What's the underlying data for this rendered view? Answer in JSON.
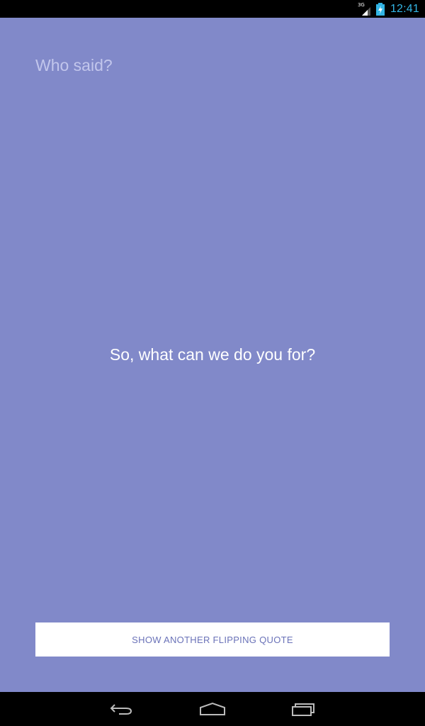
{
  "status_bar": {
    "network_label": "3G",
    "time": "12:41",
    "accent_color": "#33b5e5",
    "icons": [
      "signal-icon",
      "battery-charging-icon"
    ]
  },
  "screen": {
    "background_color": "#8189c9",
    "who_said_label": "Who said?",
    "quote_text": "So, what can we do you for?",
    "button_label": "SHOW ANOTHER FLIPPING QUOTE"
  },
  "nav_bar": {
    "icons": [
      "back-icon",
      "home-icon",
      "recent-apps-icon"
    ]
  }
}
